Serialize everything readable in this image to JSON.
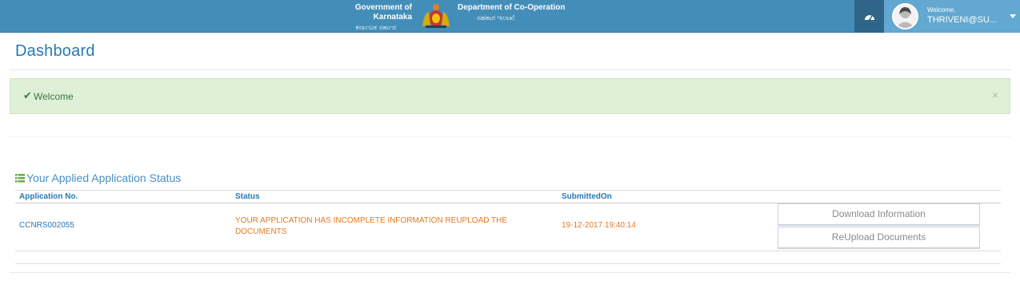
{
  "header": {
    "gov_title": "Government of Karnataka",
    "gov_title_kn": "ಕರ್ನಾಟಕ ಸರ್ಕಾರ",
    "dept_title": "Department of Co-Operation",
    "dept_title_kn": "ಸಹಕಾರ ಇಲಾಖೆ",
    "welcome": "Welcome,",
    "user_name": "THRIVENI@SU...",
    "dashboard_icon": "tachometer-icon",
    "colors": {
      "bar": "#438eb9",
      "user_area": "#62a8d1",
      "dash_btn": "#2e6589"
    }
  },
  "page": {
    "title": "Dashboard"
  },
  "alert": {
    "text": "Welcome",
    "icon": "check-icon",
    "close": "×"
  },
  "applications": {
    "title": "Your Applied Application Status",
    "icon": "list-icon",
    "columns": [
      "Application No.",
      "Status",
      "SubmittedOn"
    ],
    "rows": [
      {
        "application_no": "CCNRS002055",
        "status": "YOUR APPLICATION HAS INCOMPLETE INFORMATION REUPLOAD THE DOCUMENTS",
        "submitted_on": "19-12-2017 19:40:14",
        "actions": [
          "Download Information",
          "ReUpload Documents"
        ]
      }
    ]
  }
}
